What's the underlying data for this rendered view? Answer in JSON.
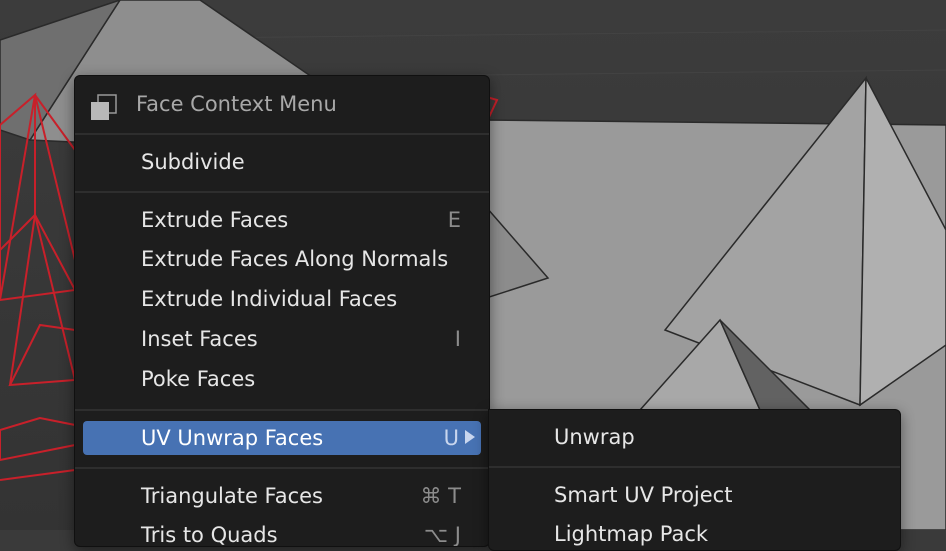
{
  "menu": {
    "title": "Face Context Menu",
    "items": [
      {
        "label": "Subdivide",
        "shortcut": ""
      },
      {
        "label": "Extrude Faces",
        "shortcut": "E"
      },
      {
        "label": "Extrude Faces Along Normals",
        "shortcut": ""
      },
      {
        "label": "Extrude Individual Faces",
        "shortcut": ""
      },
      {
        "label": "Inset Faces",
        "shortcut": "I"
      },
      {
        "label": "Poke Faces",
        "shortcut": ""
      },
      {
        "label": "UV Unwrap Faces",
        "shortcut": "U"
      },
      {
        "label": "Triangulate Faces",
        "shortcut": "⌘ T"
      },
      {
        "label": "Tris to Quads",
        "shortcut": "⌥ J"
      }
    ]
  },
  "submenu": {
    "items": [
      {
        "label": "Unwrap"
      },
      {
        "label": "Smart UV Project"
      },
      {
        "label": "Lightmap Pack"
      }
    ]
  },
  "colors": {
    "menu_bg": "#1d1d1d",
    "highlight": "#4772b3",
    "selected_edges": "#c8202a"
  }
}
